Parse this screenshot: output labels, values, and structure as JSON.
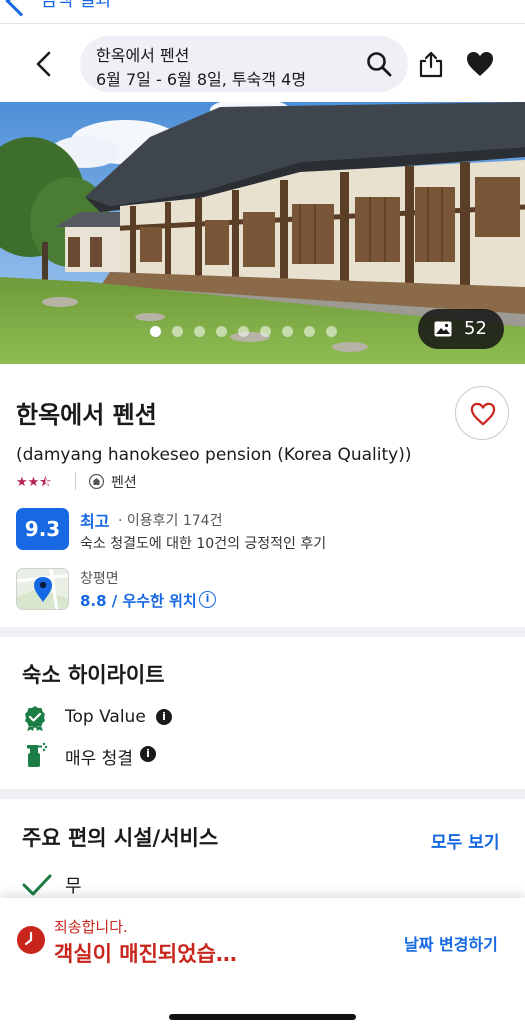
{
  "top_strip": {
    "cut_text": "검색 결과"
  },
  "header": {
    "search_line1": "한옥에서 펜션",
    "search_line2": "6월 7일 - 6월 8일, 투숙객 4명"
  },
  "gallery": {
    "photo_count": "52",
    "dot_count": 9,
    "active_dot": 0
  },
  "property": {
    "name": "한옥에서 펜션",
    "subtitle": "(damyang hanokeseo pension (Korea Quality))",
    "star_rating": 3.5,
    "stars_text": "★★⯪",
    "type": "펜션"
  },
  "rating": {
    "score": "9.3",
    "word": "최고",
    "review_count": "· 이용후기 174건",
    "note": "숙소 청결도에 대한 10건의 긍정적인 후기"
  },
  "location": {
    "area": "창평면",
    "score_text": "8.8 / 우수한 위치"
  },
  "highlights": {
    "title": "숙소 하이라이트",
    "items": [
      {
        "label": "Top Value",
        "icon": "award-ribbon-icon"
      },
      {
        "label": "매우 청결",
        "icon": "cleaning-spray-icon"
      }
    ]
  },
  "amenities": {
    "title": "주요 편의 시설/서비스",
    "see_all": "모두 보기",
    "items": [
      {
        "label": "무료 Wi-Fi",
        "icon": "checkmark-icon"
      }
    ]
  },
  "banner": {
    "sorry": "죄송합니다.",
    "message": "객실이 매진되었습…",
    "action": "날짜 변경하기"
  },
  "colors": {
    "accent_blue": "#1668e3",
    "alert_red": "#c8261d",
    "star_pink": "#b5224f",
    "highlight_green": "#1c7c45"
  }
}
